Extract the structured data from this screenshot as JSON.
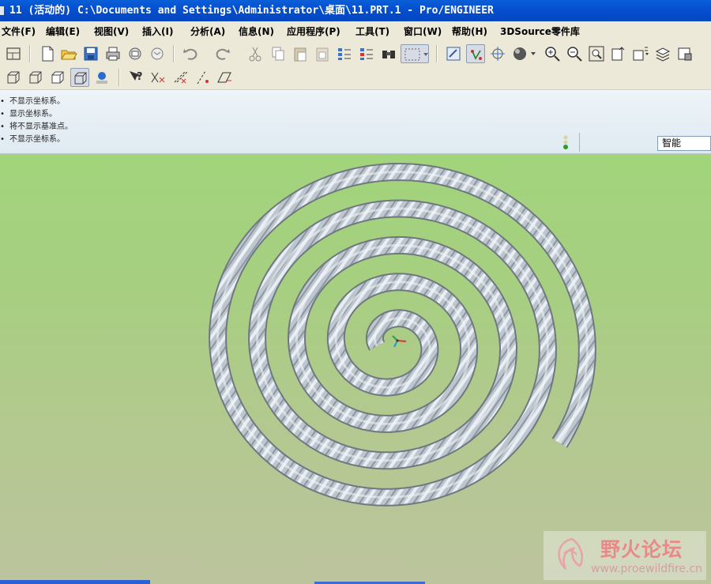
{
  "window": {
    "title": "11 (活动的) C:\\Documents and Settings\\Administrator\\桌面\\11.PRT.1 - Pro/ENGINEER"
  },
  "menu": {
    "items": [
      {
        "label": "文件(F)"
      },
      {
        "label": "编辑(E)"
      },
      {
        "label": "视图(V)"
      },
      {
        "label": "插入(I)"
      },
      {
        "label": "分析(A)"
      },
      {
        "label": "信息(N)"
      },
      {
        "label": "应用程序(P)"
      },
      {
        "label": "工具(T)"
      },
      {
        "label": "窗口(W)"
      },
      {
        "label": "帮助(H)"
      },
      {
        "label": "3DSource零件库"
      }
    ]
  },
  "toolbar1": {
    "icons": [
      "layout-icon",
      "new-file-icon",
      "open-folder-icon",
      "save-icon",
      "print-icon",
      "send-mail-icon",
      "mail-icon",
      "undo-icon",
      "redo-icon",
      "cut-icon",
      "copy-icon",
      "paste-icon",
      "paste-special-icon",
      "regenerate-icon",
      "regenerate-manager-icon",
      "find-icon",
      "select-box-icon",
      "refit-icon",
      "datum-display-icon",
      "spin-center-icon",
      "shading-icon",
      "zoom-in-icon",
      "zoom-out-icon",
      "zoom-fit-icon",
      "reorient-icon",
      "saved-views-icon",
      "layers-icon",
      "model-tree-icon"
    ]
  },
  "toolbar2": {
    "icons": [
      "wireframe-icon",
      "hidden-line-icon",
      "no-hidden-icon",
      "shaded-icon",
      "enhanced-realism-icon",
      "context-help-icon",
      "datum-planes-icon",
      "datum-axes-icon",
      "datum-points-icon",
      "coordinate-systems-icon"
    ]
  },
  "messages": {
    "lines": [
      "• 不显示坐标系。",
      "• 显示坐标系。",
      "• 将不显示基准点。",
      "• 不显示坐标系。"
    ]
  },
  "filter": {
    "value": "智能"
  },
  "watermark": {
    "title": "野火论坛",
    "url": "www.proewildfire.cn"
  },
  "colors": {
    "title_bar": "#0550d0",
    "menu_bg": "#ece9d8",
    "viewport_top": "#a2d47c",
    "viewport_bottom": "#bcc49e",
    "spiral": "#b9c2ca"
  }
}
